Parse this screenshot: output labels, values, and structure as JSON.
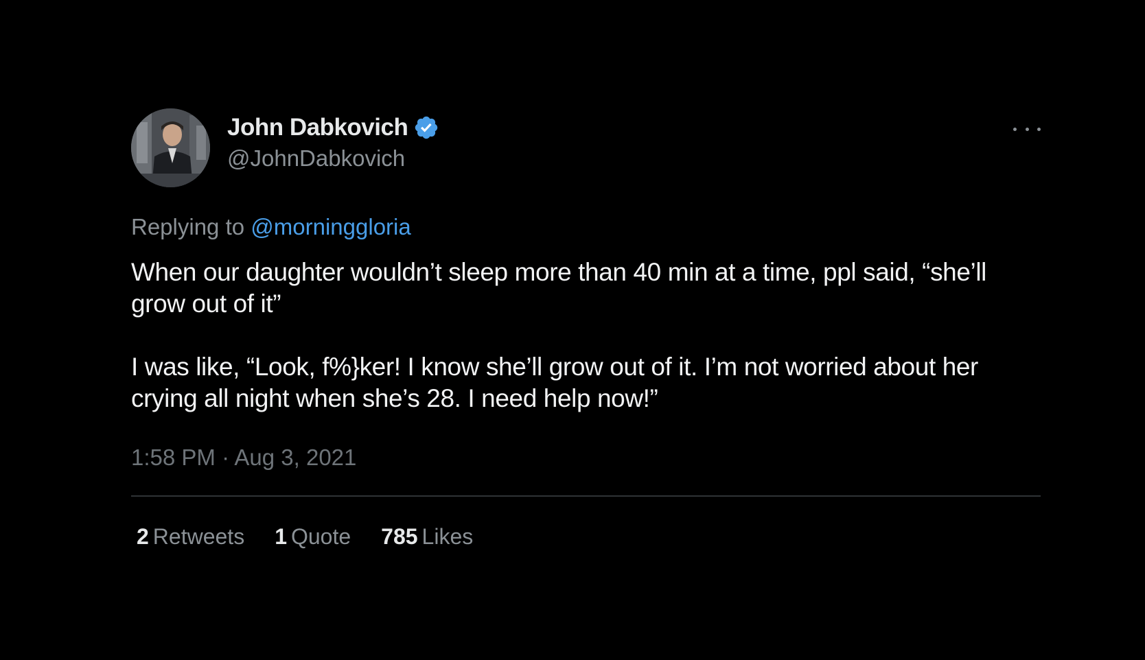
{
  "user": {
    "display_name": "John Dabkovich",
    "handle": "@JohnDabkovich",
    "verified": true,
    "avatar_icon": "profile-photo"
  },
  "reply": {
    "prefix": "Replying to",
    "to_handle": "@morninggloria"
  },
  "body": {
    "paragraph_1": "When our daughter wouldn’t sleep more than 40 min at a time, ppl said, “she’ll grow out of it”",
    "paragraph_2": "I was like, “Look, f%}ker! I know she’ll grow out of it. I’m not worried about her crying all night when she’s 28. I need help now!”"
  },
  "timestamp": "1:58 PM · Aug 3, 2021",
  "stats": {
    "retweets_count": "2",
    "retweets_label": "Retweets",
    "quotes_count": "1",
    "quotes_label": "Quote",
    "likes_count": "785",
    "likes_label": "Likes"
  },
  "colors": {
    "background": "#000000",
    "text_primary": "#e7e9ea",
    "text_secondary": "#8b9196",
    "link": "#4a9ee8",
    "verified_badge": "#4a9ee8",
    "divider": "#2f3336"
  }
}
